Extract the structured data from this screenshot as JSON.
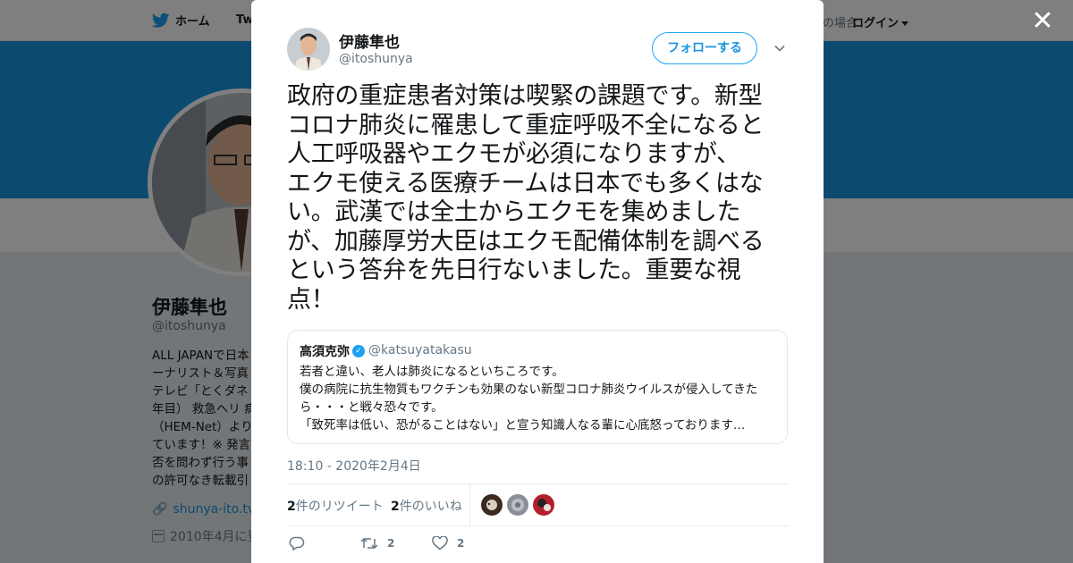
{
  "nav": {
    "home_label": "ホーム",
    "twitter_label_partial": "Tw",
    "login_prefix_partial": "の場合",
    "login_label": "ログイン"
  },
  "profile": {
    "name": "伊藤隼也",
    "handle": "@itoshunya",
    "bio_lines": [
      "ALL JAPANで日本",
      "ーナリスト＆写真",
      "テレビ「とくダネ",
      "年目） 救急ヘリ 病",
      "（HEM-Net）より",
      "ています！※ 発言",
      "否を問わず行う事",
      "の許可なき転載引"
    ],
    "url": "shunya-ito.tv",
    "joined": "2010年4月に登"
  },
  "modal": {
    "author_name": "伊藤隼也",
    "author_handle": "@itoshunya",
    "follow_label": "フォローする",
    "tweet_lines": [
      "政府の重症患者対策は喫緊の課題です。新型",
      "コロナ肺炎に罹患して重症呼吸不全になると",
      "人工呼吸器やエクモが必須になりますが、",
      "エクモ使える医療チームは日本でも多くはな",
      "い。武漢では全土からエクモを集めました",
      "が、加藤厚労大臣はエクモ配備体制を調べる",
      "という答弁を先日行ないました。重要な視",
      "点！"
    ],
    "quote": {
      "name": "高須克弥",
      "verified_mark": "✓",
      "handle": "@katsuyatakasu",
      "lines": [
        "若者と違い、老人は肺炎になるといちころです。",
        "僕の病院に抗生物質もワクチンも効果のない新型コロナ肺炎ウイルスが侵入してきた",
        "ら・・・と戦々恐々です。",
        "「致死率は低い、恐がることはない」と宣う知識人なる輩に心底怒っております…"
      ]
    },
    "timestamp": "18:10 - 2020年2月4日",
    "retweet_count": "2",
    "retweet_label": "件のリツイート",
    "like_count": "2",
    "like_label": "件のいいね",
    "action_retweet_count": "2",
    "action_like_count": "2"
  },
  "colors": {
    "brand": "#1da1f2",
    "banner": "#1b95e0",
    "text": "#14171a",
    "muted": "#657786"
  }
}
